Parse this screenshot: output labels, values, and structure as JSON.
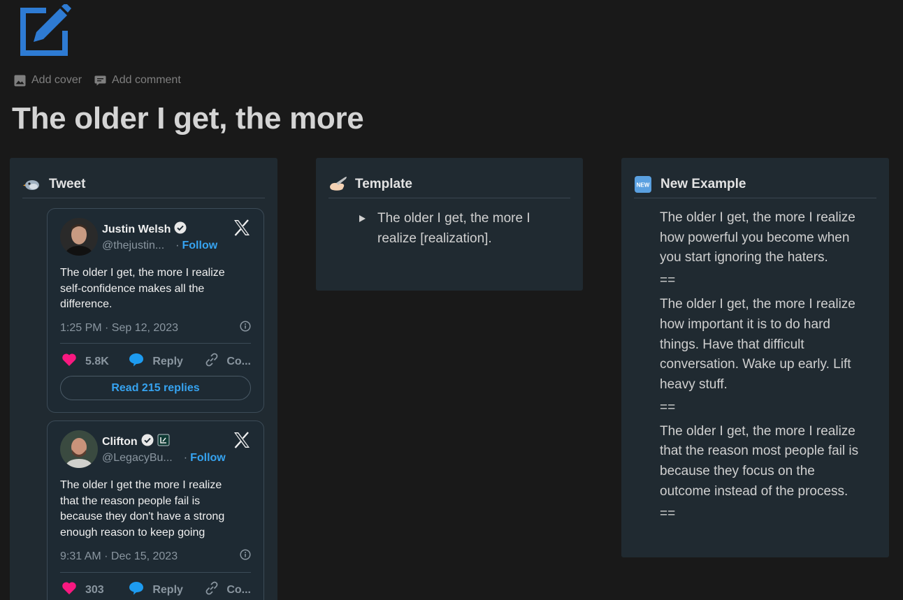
{
  "page": {
    "icon": "edit-square-icon",
    "title": "The older I get, the more",
    "actions": {
      "add_cover": "Add cover",
      "add_comment": "Add comment"
    }
  },
  "columns": {
    "tweet": {
      "emoji": "bird-emoji",
      "heading": "Tweet",
      "tweets": [
        {
          "author": "Justin Welsh",
          "handle": "@thejustin...",
          "follow": "Follow",
          "text_lines": [
            "The older I get, the more I realize",
            "self-confidence makes all the",
            "difference."
          ],
          "timestamp": "1:25 PM · Sep 12, 2023",
          "likes": "5.8K",
          "reply": "Reply",
          "copy": "Co...",
          "read_replies": "Read 215 replies"
        },
        {
          "author": "Clifton",
          "handle": "@LegacyBu...",
          "follow": "Follow",
          "text_lines": [
            "The older I get the more I realize",
            "that the reason people fail is",
            "because they don't have a strong",
            "enough reason to keep going"
          ],
          "timestamp": "9:31 AM · Dec 15, 2023",
          "likes": "303",
          "reply": "Reply",
          "copy": "Co..."
        }
      ]
    },
    "template": {
      "emoji": "writing-hand-emoji",
      "heading": "Template",
      "toggle_lines": [
        "The older I get, the more I",
        "realize [realization]."
      ]
    },
    "example": {
      "emoji": "new-button-emoji",
      "emoji_text": "NEW",
      "heading": "New Example",
      "paragraphs": [
        [
          "The older I get, the more I realize",
          "how powerful you become when",
          "you start ignoring the haters."
        ],
        [
          "The older I get, the more I realize",
          "how important it is to do hard",
          "things. Have that difficult",
          "conversation. Wake up early. Lift",
          "heavy stuff."
        ],
        [
          "The older I get, the more I realize",
          "that the reason most people fail is",
          "because they focus on the",
          "outcome instead of the process."
        ]
      ],
      "separator": "=="
    }
  },
  "colors": {
    "background": "#191919",
    "card": "#202a31",
    "accent_blue": "#2e7bd3",
    "link_blue": "#36a3f0",
    "like_pink": "#f91880"
  }
}
